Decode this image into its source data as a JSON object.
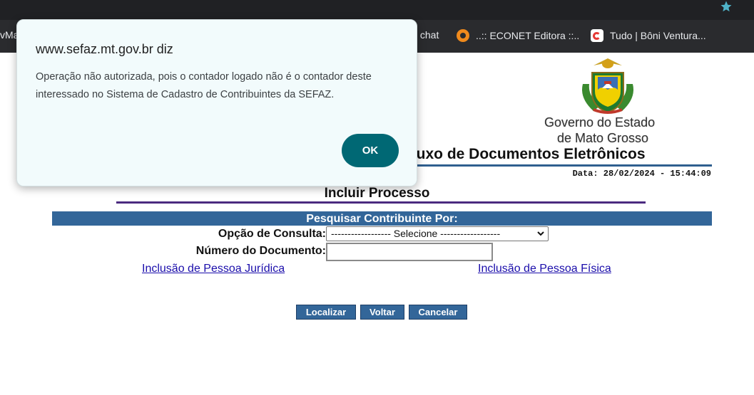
{
  "bookmarks": [
    {
      "label": "vMa",
      "icon": "bookmark-icon"
    },
    {
      "label": "v chat",
      "icon": "bookmark-icon"
    },
    {
      "label": "..:: ECONET Editora ::..",
      "icon": "econet-icon"
    },
    {
      "label": "Tudo | Bôni Ventura...",
      "icon": "boni-icon"
    }
  ],
  "header": {
    "gov_line1": "Governo do Estado",
    "gov_line2": "de Mato Grosso",
    "page_title": "Fluxo de Documentos Eletrônicos",
    "date": "Data: 28/02/2024 - 15:44:09"
  },
  "main": {
    "section_title": "Incluir Processo",
    "search_title": "Pesquisar Contribuinte Por:",
    "consulta_label": "Opção de Consulta:",
    "consulta_selected": "------------------ Selecione ------------------",
    "documento_label": "Número do Documento:",
    "documento_value": "",
    "link_juridica": "Inclusão de Pessoa Jurídica",
    "link_fisica": "Inclusão de Pessoa Física",
    "buttons": {
      "localizar": "Localizar",
      "voltar": "Voltar",
      "cancelar": "Cancelar"
    }
  },
  "dialog": {
    "title": "www.sefaz.mt.gov.br diz",
    "message": "Operação não autorizada, pois o contador logado não é o contador deste interessado no Sistema de Cadastro de Contribuintes da SEFAZ.",
    "ok_label": "OK"
  },
  "colors": {
    "accent_blue": "#336699",
    "dialog_button": "#006874",
    "section_rule": "#4b2a80"
  }
}
